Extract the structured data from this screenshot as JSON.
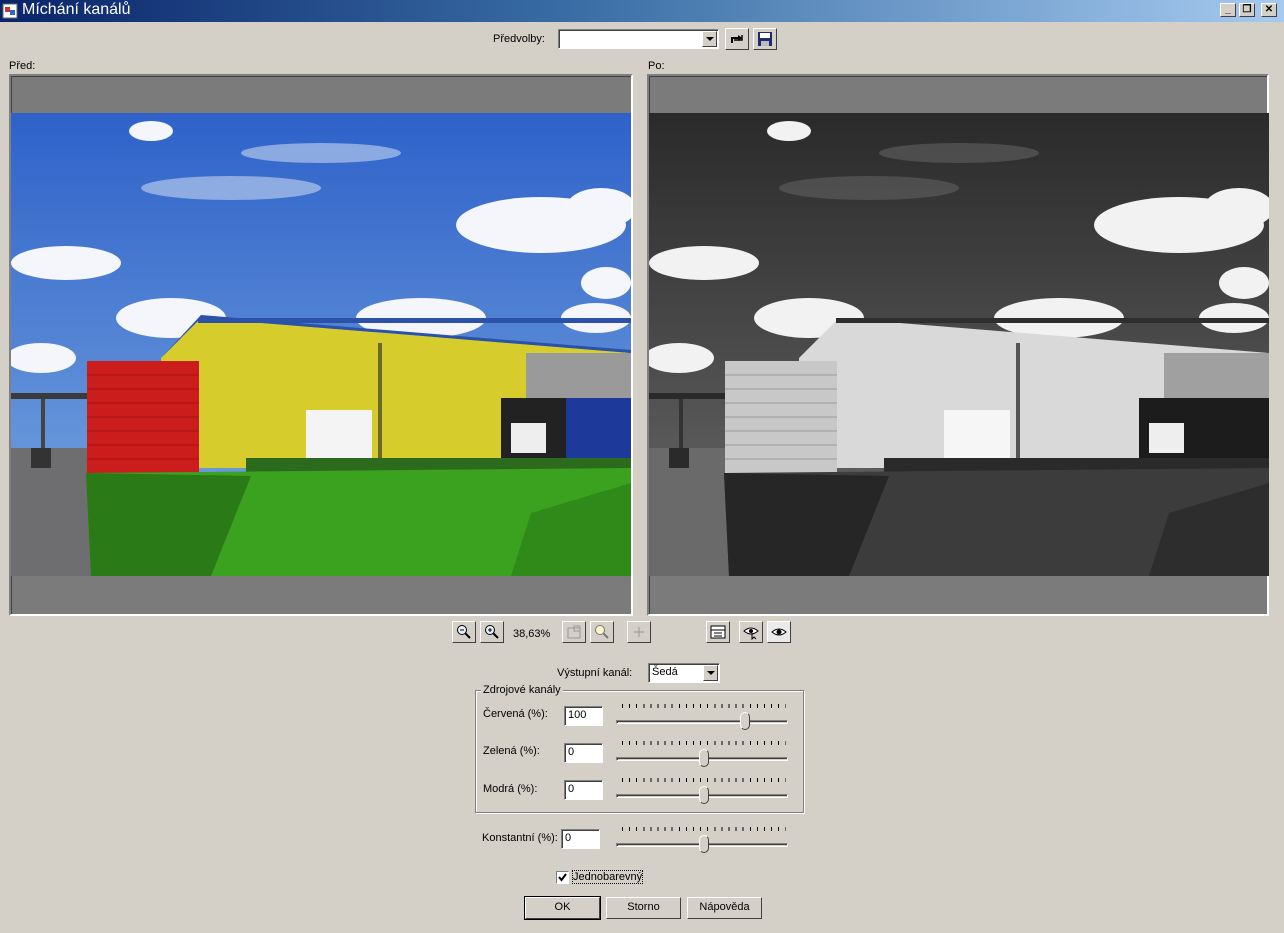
{
  "window": {
    "title": "Míchání kanálů",
    "min_label": "_",
    "restore_label": "❐",
    "close_label": "✕"
  },
  "presets": {
    "label": "Předvolby:",
    "value": ""
  },
  "before_label": "Před:",
  "after_label": "Po:",
  "zoom": {
    "value": "38,63%"
  },
  "output_channel": {
    "label": "Výstupní kanál:",
    "value": "Šedá"
  },
  "source_channels": {
    "group_label": "Zdrojové kanály",
    "red": {
      "label": "Červená (%):",
      "value": "100",
      "slider": 100,
      "range": [
        -200,
        200
      ]
    },
    "green": {
      "label": "Zelená (%):",
      "value": "0",
      "slider": 0,
      "range": [
        -200,
        200
      ]
    },
    "blue": {
      "label": "Modrá (%):",
      "value": "0",
      "slider": 0,
      "range": [
        -200,
        200
      ]
    }
  },
  "constant": {
    "label": "Konstantní (%):",
    "value": "0",
    "slider": 0,
    "range": [
      -200,
      200
    ]
  },
  "monochrome": {
    "label": "Jednobarevný",
    "checked": true
  },
  "buttons": {
    "ok": "OK",
    "cancel": "Storno",
    "help": "Nápověda"
  },
  "colors": {
    "title_start": "#0a246a",
    "title_end": "#a6caf0",
    "dialog_bg": "#d4d0c8",
    "preview_bg": "#7b7b7b"
  }
}
